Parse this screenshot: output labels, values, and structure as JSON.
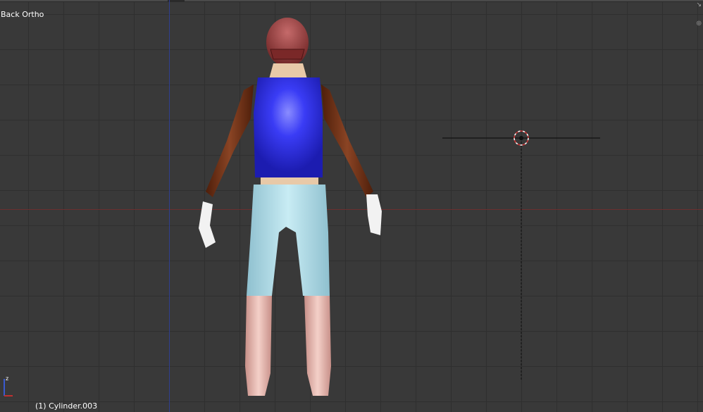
{
  "viewport": {
    "view_label": "Back Ortho",
    "active_object_label": "(1) Cylinder.003",
    "background_color": "#393939",
    "grid_color": "#2f2f2f",
    "x_axis_color": "#6b2f2f",
    "z_axis_color": "#2f3f8f"
  },
  "icons": {
    "cursor": "3d-cursor-icon",
    "axes": "axes-gizmo-icon",
    "corner": "area-split-icon"
  },
  "model": {
    "name": "character-figure",
    "colors": {
      "helmet": "#8e3434",
      "vest": "#2e2ef0",
      "sleeves": "#6e2e14",
      "gloves": "#f2f2f2",
      "pants": "#a9d6e2",
      "boots": "#e3b4ac",
      "skin": "#e8c9a8"
    }
  }
}
